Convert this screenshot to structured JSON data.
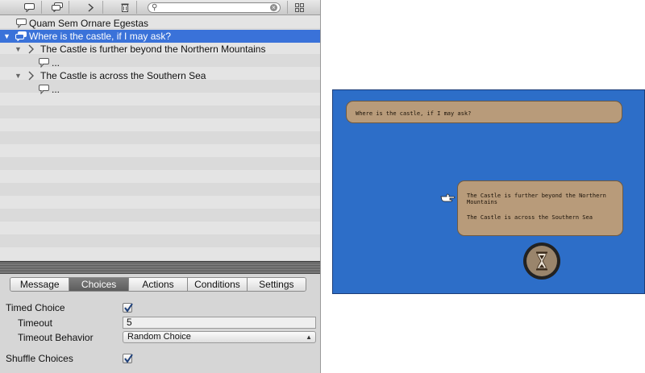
{
  "toolbar": {
    "buttons": [
      "speech-bubble-icon",
      "duplicate-bubble-icon",
      "choice-arrow-icon",
      "trash-icon"
    ],
    "search": {
      "value": "",
      "placeholder": ""
    },
    "layout_icon": "layout-grid-icon"
  },
  "tree": {
    "items": [
      {
        "label": "Quam Sem Ornare Egestas",
        "icon": "speech-bubble-icon",
        "selected": false
      },
      {
        "label": "Where is the castle, if I may ask?",
        "icon": "duplicate-bubble-icon",
        "selected": true
      },
      {
        "label": "The Castle is further beyond the Northern Mountains",
        "icon": "choice-arrow-icon",
        "selected": false
      },
      {
        "label": "...",
        "icon": "speech-bubble-icon",
        "selected": false
      },
      {
        "label": "The Castle is across the Southern Sea",
        "icon": "choice-arrow-icon",
        "selected": false
      },
      {
        "label": "...",
        "icon": "speech-bubble-icon",
        "selected": false
      }
    ]
  },
  "inspector": {
    "tabs": [
      "Message",
      "Choices",
      "Actions",
      "Conditions",
      "Settings"
    ],
    "active_tab": "Choices",
    "timed_choice": {
      "label": "Timed Choice",
      "checked": true
    },
    "timeout": {
      "label": "Timeout",
      "value": "5"
    },
    "timeout_behavior": {
      "label": "Timeout Behavior",
      "value": "Random Choice"
    },
    "shuffle": {
      "label": "Shuffle Choices",
      "checked": true
    }
  },
  "preview": {
    "npc_text": "Where is the castle, if I may ask?",
    "choices": [
      "The Castle is further beyond the Northern Mountains",
      "The Castle is across the Southern Sea"
    ],
    "timer_icon": "hourglass-icon",
    "pointer_icon": "pointing-hand-icon",
    "colors": {
      "background": "#2d6ec8",
      "bubble": "#b89b7a"
    }
  }
}
